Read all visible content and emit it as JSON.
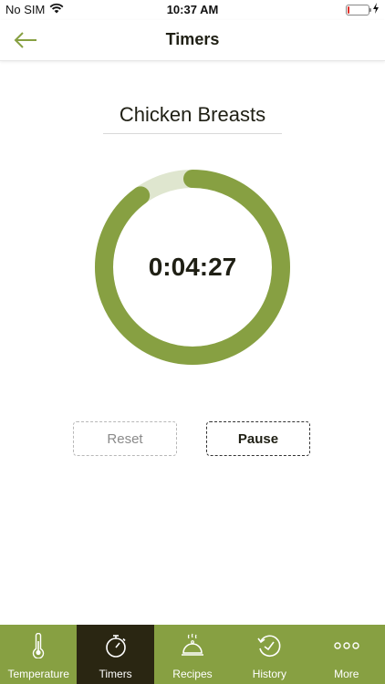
{
  "status_bar": {
    "carrier": "No SIM",
    "time": "10:37 AM"
  },
  "nav": {
    "title": "Timers"
  },
  "timer": {
    "name": "Chicken Breasts",
    "remaining": "0:04:27",
    "progress_fraction": 0.9
  },
  "buttons": {
    "reset_label": "Reset",
    "pause_label": "Pause"
  },
  "tabs": [
    {
      "label": "Temperature",
      "icon": "thermometer-icon",
      "active": false
    },
    {
      "label": "Timers",
      "icon": "stopwatch-icon",
      "active": true
    },
    {
      "label": "Recipes",
      "icon": "cloche-icon",
      "active": false
    },
    {
      "label": "History",
      "icon": "history-icon",
      "active": false
    },
    {
      "label": "More",
      "icon": "more-icon",
      "active": false
    }
  ],
  "colors": {
    "accent": "#87a042",
    "ring_track": "#dfe6cf",
    "active_tab": "#2a2612",
    "battery_low": "#e0322b"
  }
}
